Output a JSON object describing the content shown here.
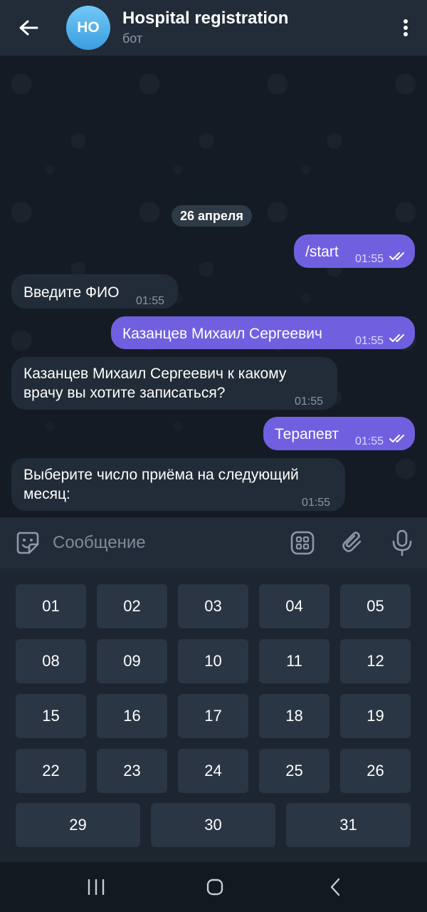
{
  "header": {
    "avatar_initials": "HO",
    "title": "Hospital registration",
    "subtitle": "бот"
  },
  "chat": {
    "date": "26 апреля",
    "messages": [
      {
        "direction": "out",
        "text": "/start",
        "time": "01:55",
        "status": "read"
      },
      {
        "direction": "in",
        "text": "Введите ФИО",
        "time": "01:55"
      },
      {
        "direction": "out",
        "text": "Казанцев Михаил Сергеевич",
        "time": "01:55",
        "status": "read"
      },
      {
        "direction": "in",
        "line1": "Казанцев Михаил Сергеевич к какому",
        "line2": "врачу вы хотите записаться?",
        "time": "01:55"
      },
      {
        "direction": "out",
        "text": "Терапевт",
        "time": "01:55",
        "status": "read"
      },
      {
        "direction": "in",
        "line1": "Выберите число приёма на следующий",
        "line2": "месяц:",
        "time": "01:55"
      }
    ]
  },
  "composer": {
    "placeholder": "Сообщение"
  },
  "keyboard": {
    "row1": [
      "01",
      "02",
      "03",
      "04",
      "05"
    ],
    "row2": [
      "08",
      "09",
      "10",
      "11",
      "12"
    ],
    "row3": [
      "15",
      "16",
      "17",
      "18",
      "19"
    ],
    "row4": [
      "22",
      "23",
      "24",
      "25",
      "26"
    ],
    "row5": [
      "29",
      "30",
      "31"
    ]
  },
  "colors": {
    "outgoing_bubble": "#7060e0",
    "incoming_bubble": "#222c38",
    "avatar": "#4aa8e8",
    "key": "#2a3644"
  },
  "icons": [
    "arrow-left-icon",
    "more-vertical-icon",
    "sticker-icon",
    "bot-menu-icon",
    "attach-icon",
    "microphone-icon",
    "double-check-icon",
    "recent-apps-icon",
    "home-icon",
    "back-icon"
  ]
}
